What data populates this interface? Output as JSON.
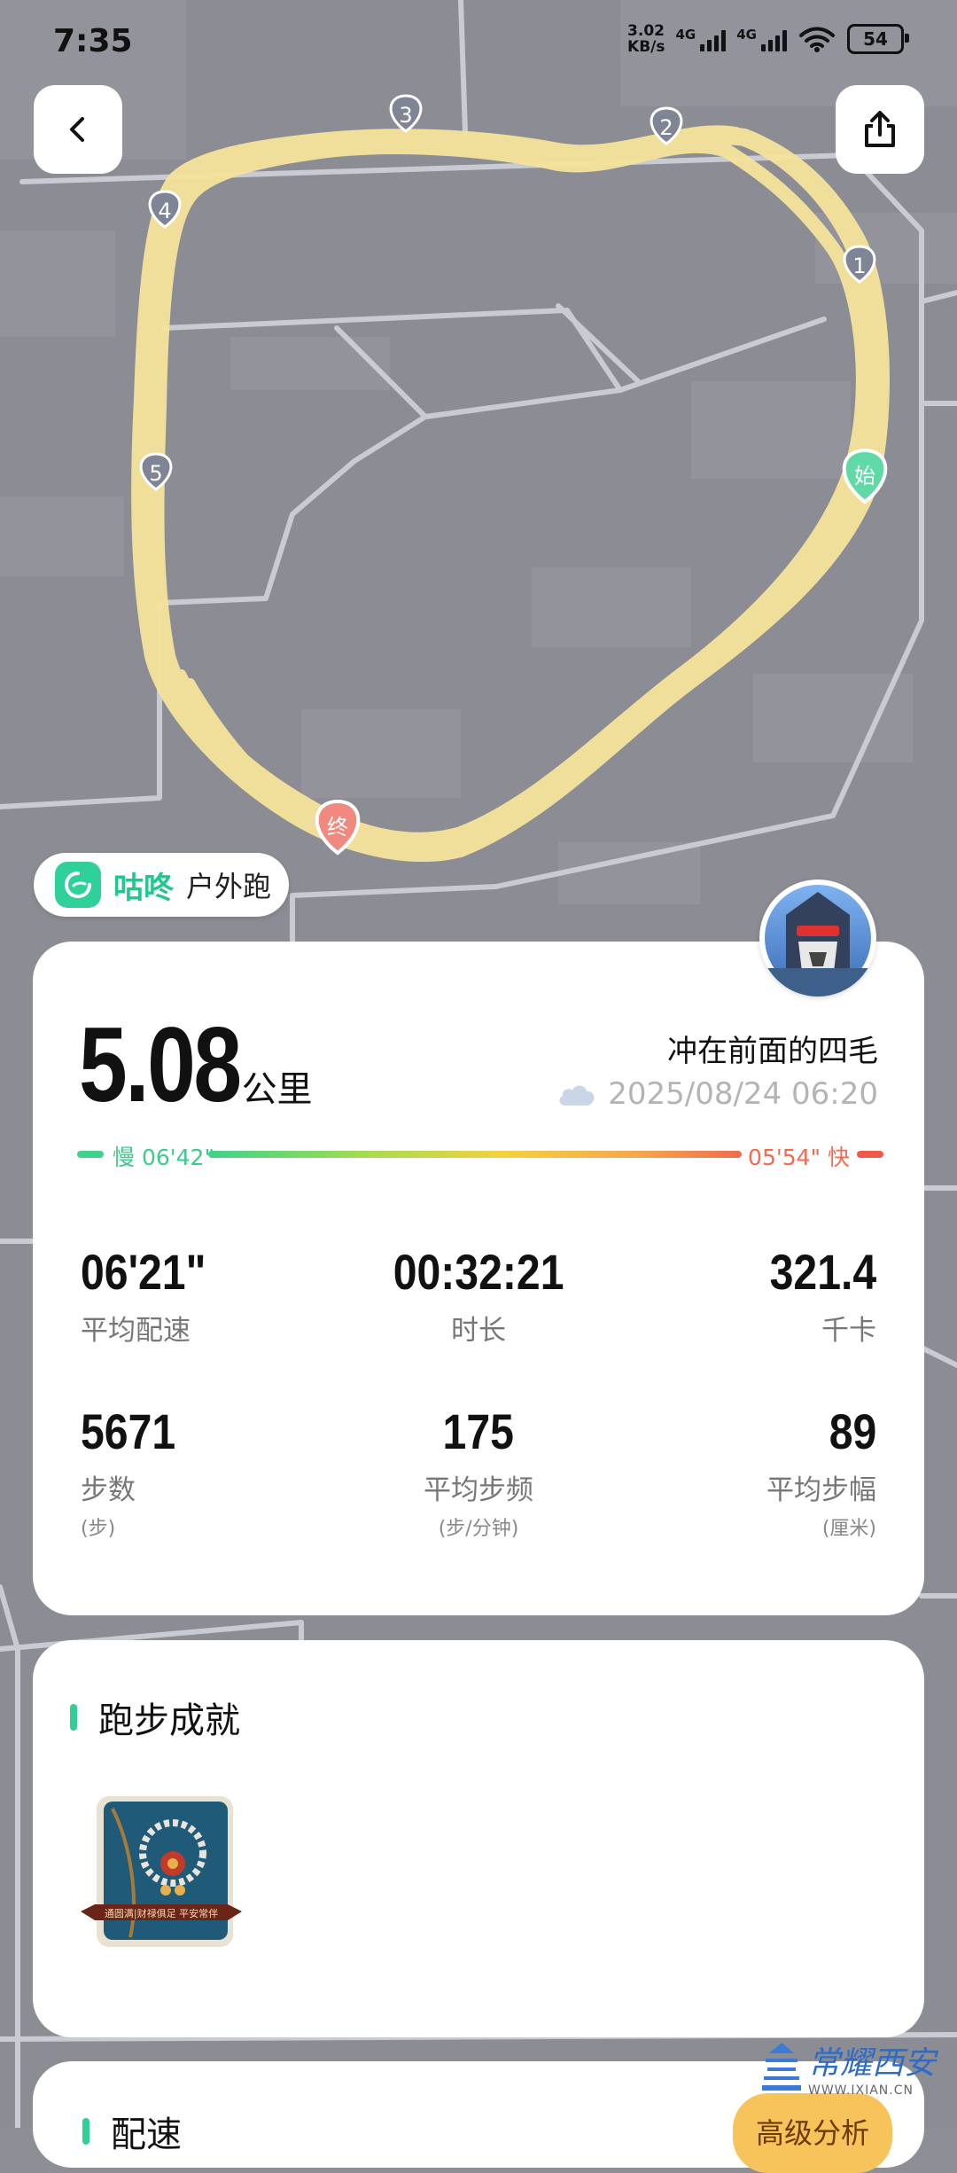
{
  "status_bar": {
    "time": "7:35",
    "net_speed_value": "3.02",
    "net_speed_unit": "KB/s",
    "signal_label_1": "4G",
    "signal_label_2": "4G",
    "battery": "54"
  },
  "map": {
    "route_color": "#f5e49b",
    "km_markers": [
      "1",
      "2",
      "3",
      "4",
      "5"
    ],
    "start_label": "始",
    "end_label": "终",
    "start_color": "#5fd9a6",
    "end_color": "#f08a80"
  },
  "brand": {
    "name": "咕咚",
    "activity_type": "户外跑"
  },
  "summary": {
    "distance": "5.08",
    "distance_unit": "公里",
    "user_name": "冲在前面的四毛",
    "date": "2025/08/24 06:20",
    "pace_slow": "慢 06'42\"",
    "pace_fast": "05'54\" 快"
  },
  "metrics": [
    {
      "value": "06'21\"",
      "label": "平均配速"
    },
    {
      "value": "00:32:21",
      "label": "时长"
    },
    {
      "value": "321.4",
      "label": "千卡"
    },
    {
      "value": "5671",
      "label": "步数",
      "sub": "(步)"
    },
    {
      "value": "175",
      "label": "平均步频",
      "sub": "(步/分钟)"
    },
    {
      "value": "89",
      "label": "平均步幅",
      "sub": "(厘米)"
    }
  ],
  "achievements": {
    "title": "跑步成就",
    "medal_caption": "通圆满|财禄俱足 平安常伴"
  },
  "pace_section": {
    "title": "配速",
    "advanced_button": "高级分析"
  },
  "watermark": {
    "cn": "常耀西安",
    "en": "WWW.IXIAN.CN"
  }
}
